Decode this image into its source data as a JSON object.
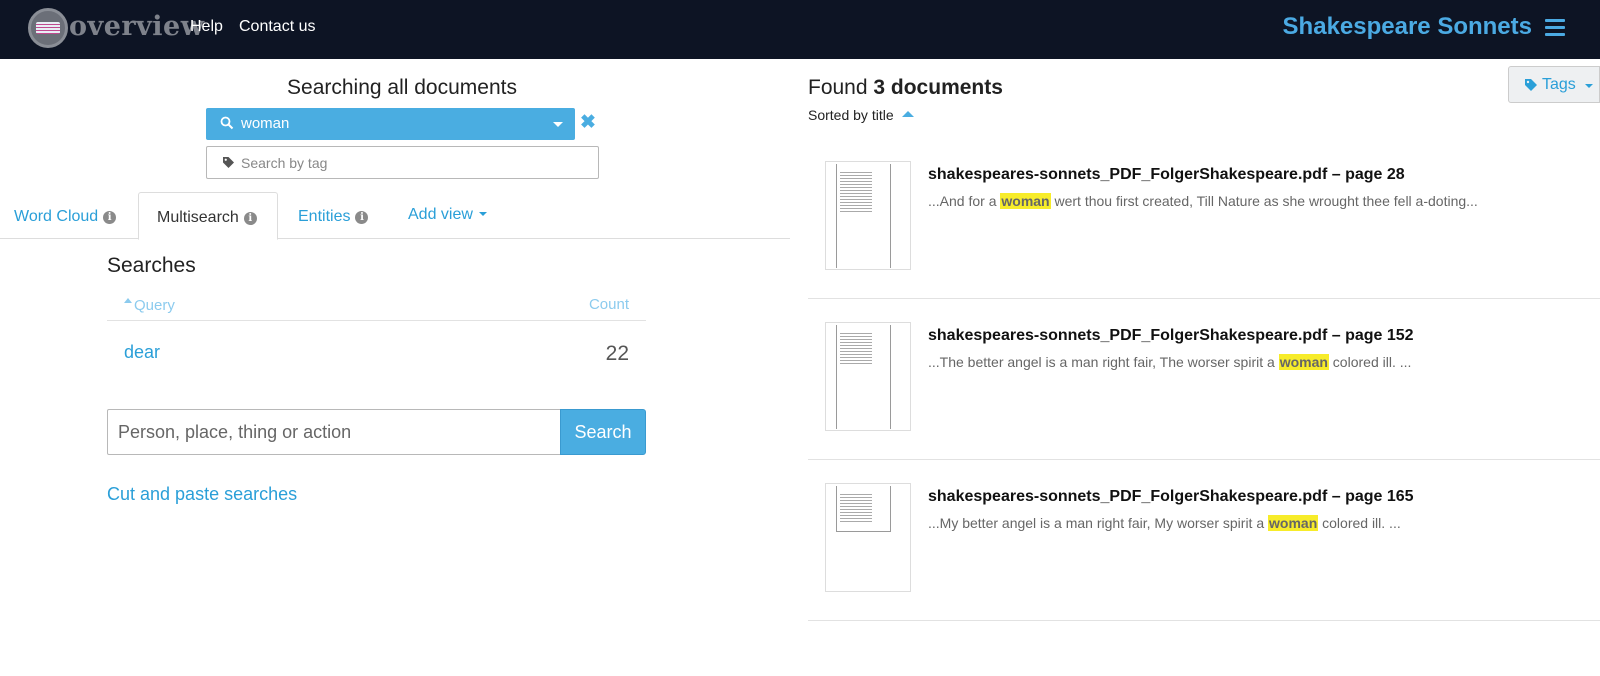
{
  "header": {
    "logo_text": "overview",
    "nav": [
      "Help",
      "Contact us"
    ],
    "project_title": "Shakespeare Sonnets"
  },
  "search": {
    "heading": "Searching all documents",
    "query": "woman",
    "tag_placeholder": "Search by tag"
  },
  "tabs": [
    {
      "label": "Word Cloud"
    },
    {
      "label": "Multisearch"
    },
    {
      "label": "Entities"
    },
    {
      "label": "Add view"
    }
  ],
  "multisearch": {
    "title": "Searches",
    "col_query": "Query",
    "col_count": "Count",
    "rows": [
      {
        "query": "dear",
        "count": "22"
      }
    ],
    "input_placeholder": "Person, place, thing or action",
    "search_button": "Search",
    "cut_paste": "Cut and paste searches"
  },
  "results": {
    "found_prefix": "Found",
    "found_count": "3 documents",
    "sorted_by": "Sorted by title",
    "tags_button": "Tags",
    "docs": [
      {
        "title": "shakespeares-sonnets_PDF_FolgerShakespeare.pdf – page 28",
        "before": "...And for a ",
        "hit": "woman",
        "after": " wert thou first created, Till Nature as she wrought thee fell a-doting..."
      },
      {
        "title": "shakespeares-sonnets_PDF_FolgerShakespeare.pdf – page 152",
        "before": "...The better angel is a man right fair, The worser spirit a ",
        "hit": "woman",
        "after": " colored ill. ..."
      },
      {
        "title": "shakespeares-sonnets_PDF_FolgerShakespeare.pdf – page 165",
        "before": "...My better angel is a man right fair, My worser spirit a ",
        "hit": "woman",
        "after": " colored ill. ..."
      }
    ]
  },
  "colors": {
    "topbar": "#0d1424",
    "accent": "#4aade1",
    "link": "#2a9fd8",
    "highlight": "#f7ec2a"
  }
}
